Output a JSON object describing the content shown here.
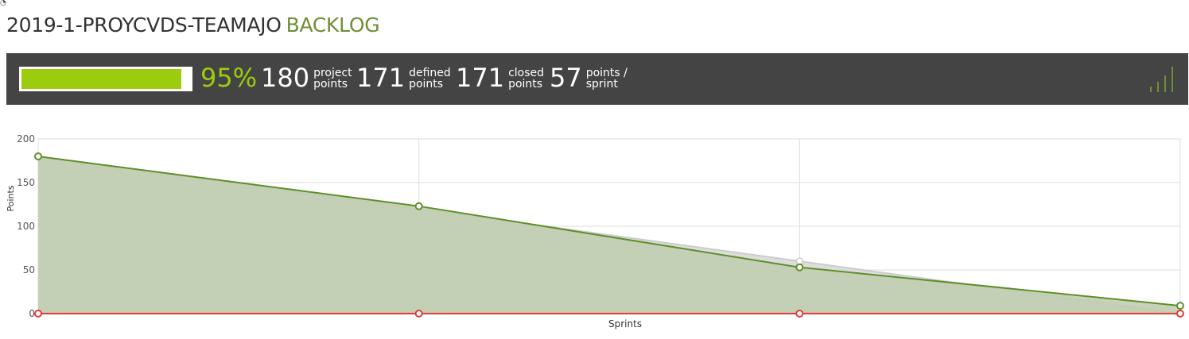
{
  "header": {
    "project_name": "2019-1-PROYCVDS-TEAMAJO",
    "section_name": "BACKLOG"
  },
  "summary": {
    "progress_fraction": 0.95,
    "percent_label": "95%",
    "project_points": {
      "value": "180",
      "label_line1": "project",
      "label_line2": "points"
    },
    "defined_points": {
      "value": "171",
      "label_line1": "defined",
      "label_line2": "points"
    },
    "closed_points": {
      "value": "171",
      "label_line1": "closed",
      "label_line2": "points"
    },
    "points_per_sprint": {
      "value": "57",
      "label_line1": "points /",
      "label_line2": "sprint"
    }
  },
  "icons": {
    "stats_toggle": "signal-bars-icon",
    "corner": "corner-icon"
  },
  "colors": {
    "bar_background": "#444444",
    "progress": "#9dcc0e",
    "section_title": "#6f8f35",
    "actual_line": "#5e8f2a",
    "actual_fill": "#c1ceb0",
    "optimal_fill": "#d7d7d7",
    "zero_line": "#e33b3b"
  },
  "chart_data": {
    "type": "area",
    "xlabel": "Sprints",
    "ylabel": "Points",
    "ylim": [
      0,
      200
    ],
    "yticks": [
      "0",
      "50",
      "100",
      "150",
      "200"
    ],
    "x": [
      0,
      1,
      2,
      3
    ],
    "grid": true,
    "series": [
      {
        "role": "optimal",
        "values": [
          180,
          120,
          60,
          0
        ]
      },
      {
        "role": "actual",
        "values": [
          180,
          123,
          53,
          9
        ]
      },
      {
        "role": "zero",
        "values": [
          0,
          0,
          0,
          0
        ]
      }
    ]
  }
}
